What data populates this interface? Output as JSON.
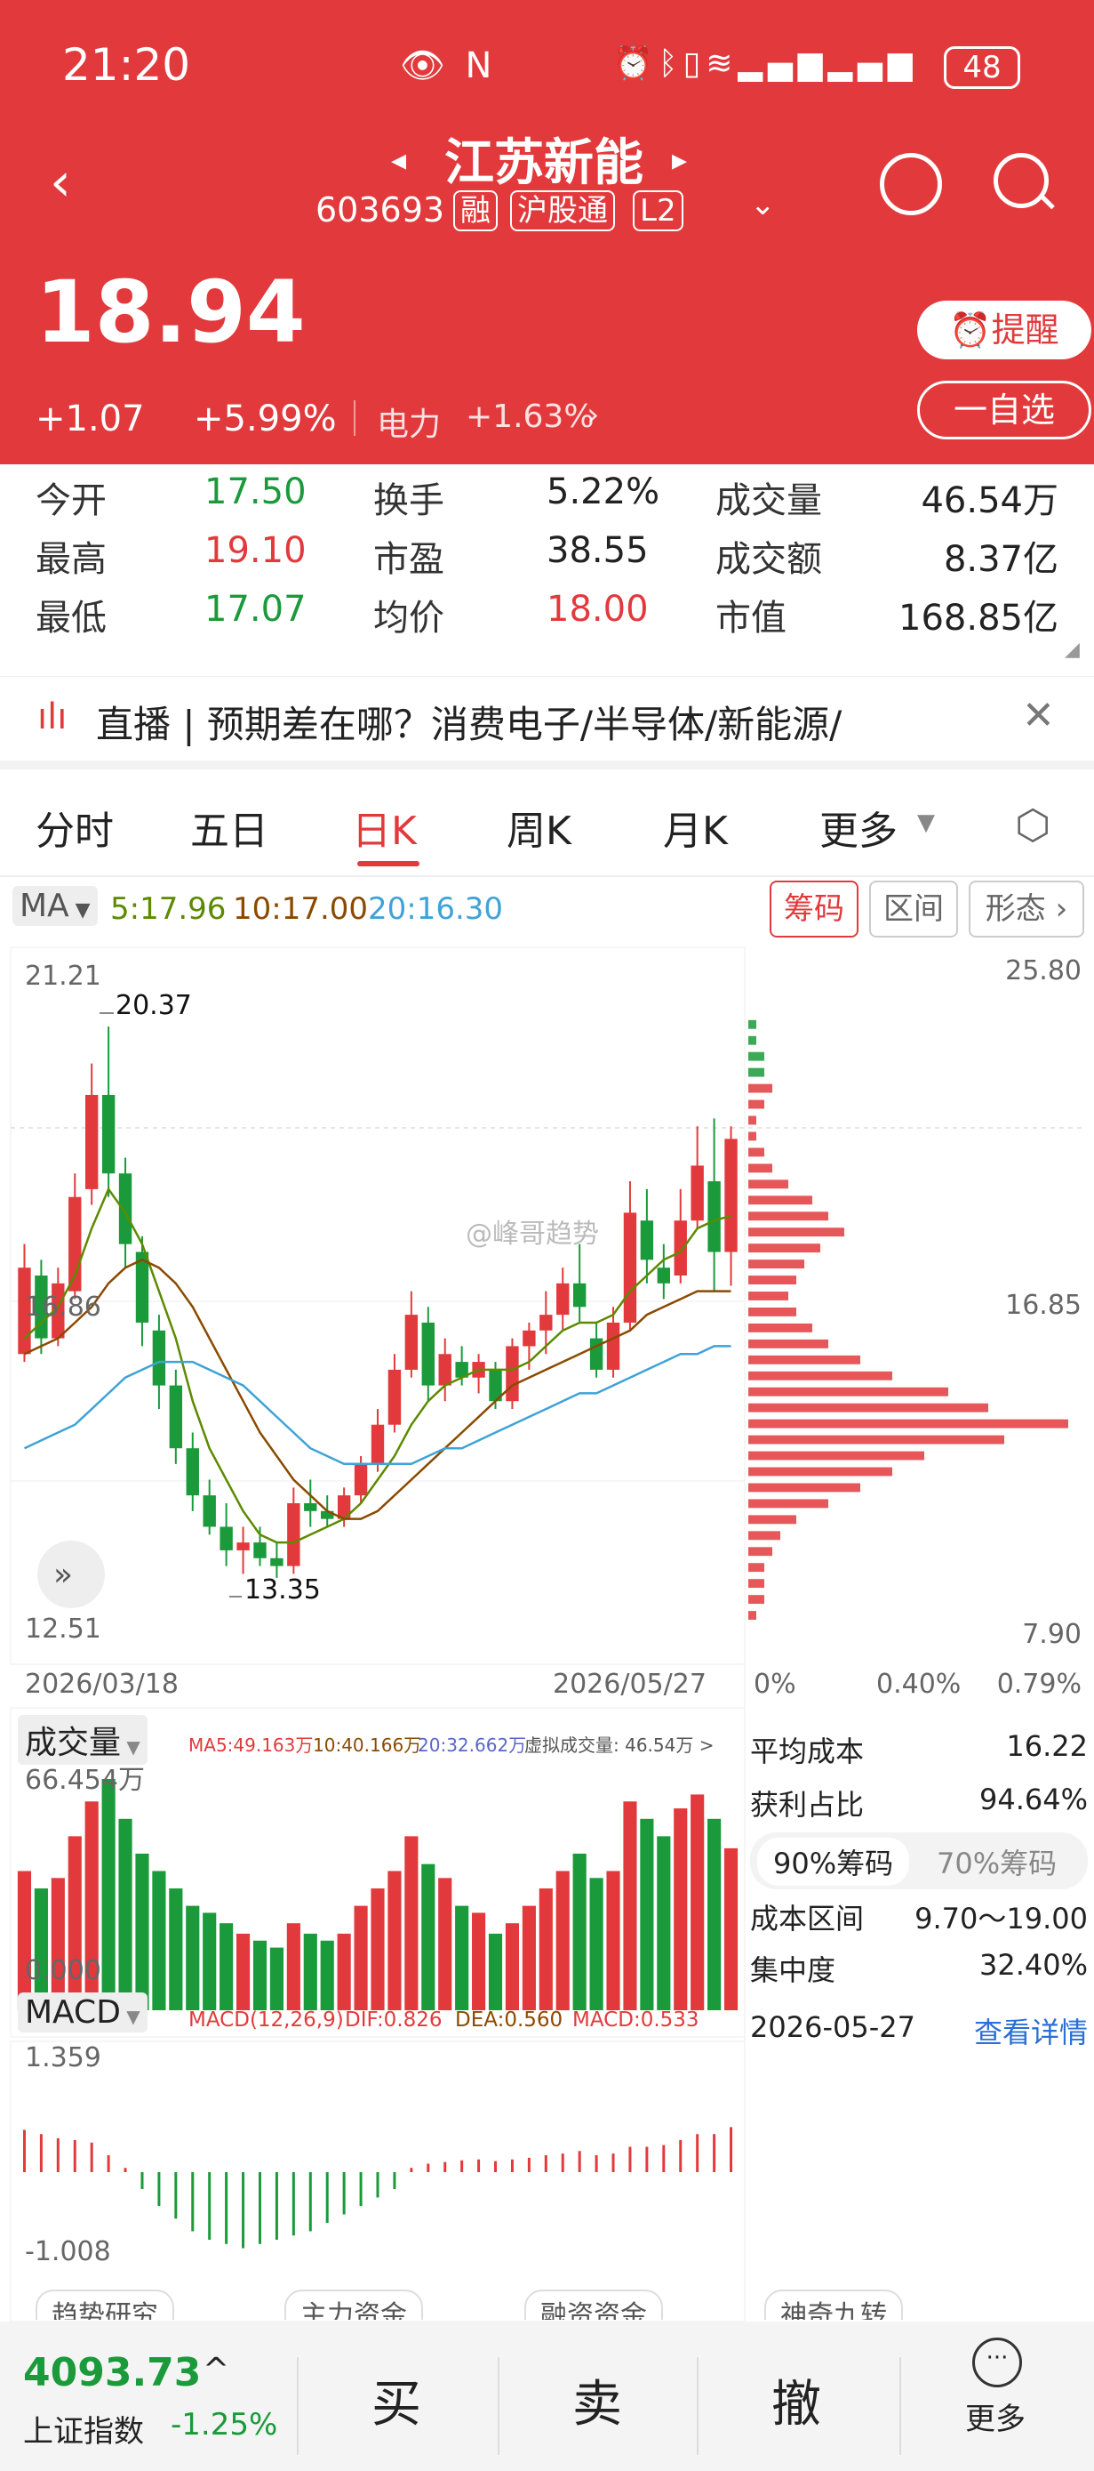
{
  "status": {
    "time": "21:20",
    "battery": "48"
  },
  "header": {
    "title": "江苏新能",
    "code": "603693",
    "tags": [
      "融",
      "沪股通",
      "L2"
    ],
    "price": "18.94",
    "change": "+1.07",
    "change_pct": "+5.99%",
    "sector": "电力",
    "sector_pct": "+1.63%",
    "remind_label": "提醒",
    "watch_label": "一自选"
  },
  "stats": {
    "open_label": "今开",
    "open": "17.50",
    "turnover_label": "换手",
    "turnover": "5.22%",
    "volume_label": "成交量",
    "volume": "46.54万",
    "high_label": "最高",
    "high": "19.10",
    "pe_label": "市盈",
    "pe": "38.55",
    "amount_label": "成交额",
    "amount": "8.37亿",
    "low_label": "最低",
    "low": "17.07",
    "avg_label": "均价",
    "avg": "18.00",
    "mcap_label": "市值",
    "mcap": "168.85亿"
  },
  "news": "直播 | 预期差在哪？消费电子/半导体/新能源/",
  "tabs": [
    "分时",
    "五日",
    "日K",
    "周K",
    "月K",
    "更多"
  ],
  "ma": {
    "label": "MA",
    "ma5": "5:17.96",
    "ma10": "10:17.00",
    "ma20": "20:16.30"
  },
  "chip_tabs": [
    "筹码",
    "区间",
    "形态"
  ],
  "kline": {
    "y_top": "21.21",
    "y_mid": "16.86",
    "y_bot": "12.51",
    "high_mark": "20.37",
    "low_mark": "13.35",
    "date_start": "2026/03/18",
    "date_end": "2026/05/27",
    "watermark": "@峰哥趋势"
  },
  "chip_axis": {
    "top": "25.80",
    "mid": "16.85",
    "bot": "7.90",
    "x0": "0%",
    "x1": "0.40%",
    "x2": "0.79%"
  },
  "volume": {
    "label": "成交量",
    "max": "66.454万",
    "zero": "0.000",
    "ma5": "MA5:49.163万",
    "ma10": "10:40.166万",
    "ma20": "20:32.662万",
    "virtual": "虚拟成交量: 46.54万 >"
  },
  "macd": {
    "label": "MACD",
    "params": "MACD(12,26,9)",
    "dif": "DIF:0.826",
    "dea": "DEA:0.560",
    "macd": "MACD:0.533",
    "top": "1.359",
    "bot": "-1.008"
  },
  "chip_info": {
    "avg_cost_label": "平均成本",
    "avg_cost": "16.22",
    "profit_label": "获利占比",
    "profit": "94.64%",
    "tab90": "90%筹码",
    "tab70": "70%筹码",
    "range_label": "成本区间",
    "range": "9.70～19.00",
    "conc_label": "集中度",
    "conc": "32.40%",
    "date": "2026-05-27",
    "detail": "查看详情"
  },
  "bottom": {
    "index_value": "4093.73",
    "index_name": "上证指数",
    "index_pct": "-1.25%",
    "buy": "买",
    "sell": "卖",
    "cancel": "撤",
    "more": "更多"
  },
  "shortcuts": [
    "趋势研究",
    "主力资金",
    "融资资金",
    "神奇九转"
  ],
  "chart_data": {
    "type": "candlestick",
    "title": "江苏新能 日K",
    "x_range": [
      "2026/03/18",
      "2026/05/27"
    ],
    "ylim": [
      12.51,
      21.21
    ],
    "candles": [
      {
        "o": 16.2,
        "h": 17.6,
        "l": 16.1,
        "c": 17.3
      },
      {
        "o": 17.2,
        "h": 17.4,
        "l": 16.2,
        "c": 16.4
      },
      {
        "o": 16.4,
        "h": 17.3,
        "l": 16.3,
        "c": 17.1
      },
      {
        "o": 17.0,
        "h": 18.5,
        "l": 16.9,
        "c": 18.2
      },
      {
        "o": 18.3,
        "h": 19.9,
        "l": 18.1,
        "c": 19.5
      },
      {
        "o": 19.5,
        "h": 20.37,
        "l": 18.2,
        "c": 18.5
      },
      {
        "o": 18.5,
        "h": 18.7,
        "l": 17.3,
        "c": 17.6
      },
      {
        "o": 17.5,
        "h": 17.7,
        "l": 16.3,
        "c": 16.6
      },
      {
        "o": 16.5,
        "h": 16.7,
        "l": 15.5,
        "c": 15.8
      },
      {
        "o": 15.8,
        "h": 16.0,
        "l": 14.8,
        "c": 15.0
      },
      {
        "o": 15.0,
        "h": 15.2,
        "l": 14.2,
        "c": 14.4
      },
      {
        "o": 14.4,
        "h": 14.6,
        "l": 13.9,
        "c": 14.0
      },
      {
        "o": 14.0,
        "h": 14.3,
        "l": 13.5,
        "c": 13.7
      },
      {
        "o": 13.7,
        "h": 14.0,
        "l": 13.4,
        "c": 13.8
      },
      {
        "o": 13.8,
        "h": 14.0,
        "l": 13.5,
        "c": 13.6
      },
      {
        "o": 13.6,
        "h": 13.8,
        "l": 13.35,
        "c": 13.5
      },
      {
        "o": 13.5,
        "h": 14.5,
        "l": 13.4,
        "c": 14.3
      },
      {
        "o": 14.3,
        "h": 14.6,
        "l": 14.0,
        "c": 14.2
      },
      {
        "o": 14.2,
        "h": 14.4,
        "l": 14.0,
        "c": 14.1
      },
      {
        "o": 14.1,
        "h": 14.5,
        "l": 14.0,
        "c": 14.4
      },
      {
        "o": 14.4,
        "h": 14.9,
        "l": 14.3,
        "c": 14.8
      },
      {
        "o": 14.8,
        "h": 15.5,
        "l": 14.7,
        "c": 15.3
      },
      {
        "o": 15.3,
        "h": 16.2,
        "l": 15.2,
        "c": 16.0
      },
      {
        "o": 16.0,
        "h": 17.0,
        "l": 15.9,
        "c": 16.7
      },
      {
        "o": 16.6,
        "h": 16.8,
        "l": 15.6,
        "c": 15.8
      },
      {
        "o": 15.8,
        "h": 16.4,
        "l": 15.6,
        "c": 16.2
      },
      {
        "o": 16.1,
        "h": 16.3,
        "l": 15.8,
        "c": 15.9
      },
      {
        "o": 15.9,
        "h": 16.2,
        "l": 15.7,
        "c": 16.1
      },
      {
        "o": 16.0,
        "h": 16.1,
        "l": 15.5,
        "c": 15.6
      },
      {
        "o": 15.6,
        "h": 16.4,
        "l": 15.5,
        "c": 16.3
      },
      {
        "o": 16.3,
        "h": 16.6,
        "l": 16.0,
        "c": 16.5
      },
      {
        "o": 16.5,
        "h": 17.0,
        "l": 16.2,
        "c": 16.7
      },
      {
        "o": 16.7,
        "h": 17.3,
        "l": 16.5,
        "c": 17.1
      },
      {
        "o": 17.1,
        "h": 17.6,
        "l": 16.6,
        "c": 16.8
      },
      {
        "o": 16.4,
        "h": 16.6,
        "l": 15.9,
        "c": 16.0
      },
      {
        "o": 16.0,
        "h": 16.8,
        "l": 15.9,
        "c": 16.6
      },
      {
        "o": 16.6,
        "h": 18.4,
        "l": 16.5,
        "c": 18.0
      },
      {
        "o": 17.9,
        "h": 18.3,
        "l": 17.1,
        "c": 17.4
      },
      {
        "o": 17.3,
        "h": 17.6,
        "l": 16.9,
        "c": 17.1
      },
      {
        "o": 17.2,
        "h": 18.3,
        "l": 17.1,
        "c": 17.9
      },
      {
        "o": 17.9,
        "h": 19.1,
        "l": 17.8,
        "c": 18.6
      },
      {
        "o": 18.4,
        "h": 19.2,
        "l": 17.0,
        "c": 17.5
      },
      {
        "o": 17.5,
        "h": 19.1,
        "l": 17.07,
        "c": 18.94
      }
    ],
    "ma5": [
      16.4,
      16.6,
      16.8,
      17.2,
      17.8,
      18.3,
      18.0,
      17.6,
      17.0,
      16.4,
      15.6,
      15.0,
      14.6,
      14.2,
      13.9,
      13.8,
      13.8,
      13.9,
      14.0,
      14.1,
      14.3,
      14.6,
      14.9,
      15.3,
      15.6,
      15.8,
      15.9,
      16.0,
      16.0,
      16.0,
      16.1,
      16.3,
      16.5,
      16.6,
      16.6,
      16.7,
      17.0,
      17.2,
      17.4,
      17.5,
      17.8,
      17.9,
      17.96
    ],
    "ma10": [
      16.2,
      16.3,
      16.4,
      16.6,
      16.8,
      17.1,
      17.3,
      17.4,
      17.3,
      17.1,
      16.8,
      16.4,
      16.0,
      15.6,
      15.2,
      14.9,
      14.6,
      14.4,
      14.2,
      14.1,
      14.1,
      14.2,
      14.4,
      14.6,
      14.8,
      15.0,
      15.2,
      15.4,
      15.6,
      15.8,
      15.9,
      16.0,
      16.1,
      16.2,
      16.3,
      16.4,
      16.5,
      16.7,
      16.8,
      16.9,
      17.0,
      17.0,
      17.0
    ],
    "ma20": [
      15.0,
      15.1,
      15.2,
      15.3,
      15.5,
      15.7,
      15.9,
      16.0,
      16.1,
      16.1,
      16.1,
      16.0,
      15.9,
      15.8,
      15.6,
      15.4,
      15.2,
      15.0,
      14.9,
      14.8,
      14.8,
      14.8,
      14.8,
      14.8,
      14.9,
      15.0,
      15.0,
      15.1,
      15.2,
      15.3,
      15.4,
      15.5,
      15.6,
      15.7,
      15.7,
      15.8,
      15.9,
      16.0,
      16.1,
      16.2,
      16.2,
      16.3,
      16.3
    ],
    "volume": [
      40,
      35,
      38,
      50,
      60,
      66.454,
      55,
      45,
      40,
      35,
      30,
      28,
      25,
      22,
      20,
      18,
      25,
      22,
      20,
      22,
      30,
      35,
      40,
      50,
      42,
      38,
      30,
      28,
      22,
      25,
      30,
      35,
      40,
      45,
      38,
      40,
      60,
      55,
      50,
      58,
      62,
      55,
      46.54
    ],
    "macd_hist": [
      0.5,
      0.45,
      0.4,
      0.38,
      0.35,
      0.2,
      0.05,
      -0.2,
      -0.4,
      -0.55,
      -0.7,
      -0.8,
      -0.85,
      -0.9,
      -0.85,
      -0.8,
      -0.75,
      -0.7,
      -0.6,
      -0.5,
      -0.4,
      -0.3,
      -0.2,
      0.05,
      0.1,
      0.12,
      0.14,
      0.15,
      0.13,
      0.15,
      0.17,
      0.2,
      0.22,
      0.25,
      0.2,
      0.22,
      0.3,
      0.3,
      0.32,
      0.38,
      0.45,
      0.45,
      0.533
    ],
    "chip_profile": [
      0,
      0,
      0,
      0,
      1,
      1,
      2,
      2,
      3,
      2,
      1,
      1,
      2,
      3,
      5,
      8,
      10,
      12,
      9,
      7,
      6,
      5,
      6,
      8,
      10,
      14,
      18,
      25,
      30,
      40,
      32,
      22,
      18,
      14,
      10,
      6,
      4,
      3,
      2,
      2,
      2,
      1,
      0,
      0
    ]
  }
}
